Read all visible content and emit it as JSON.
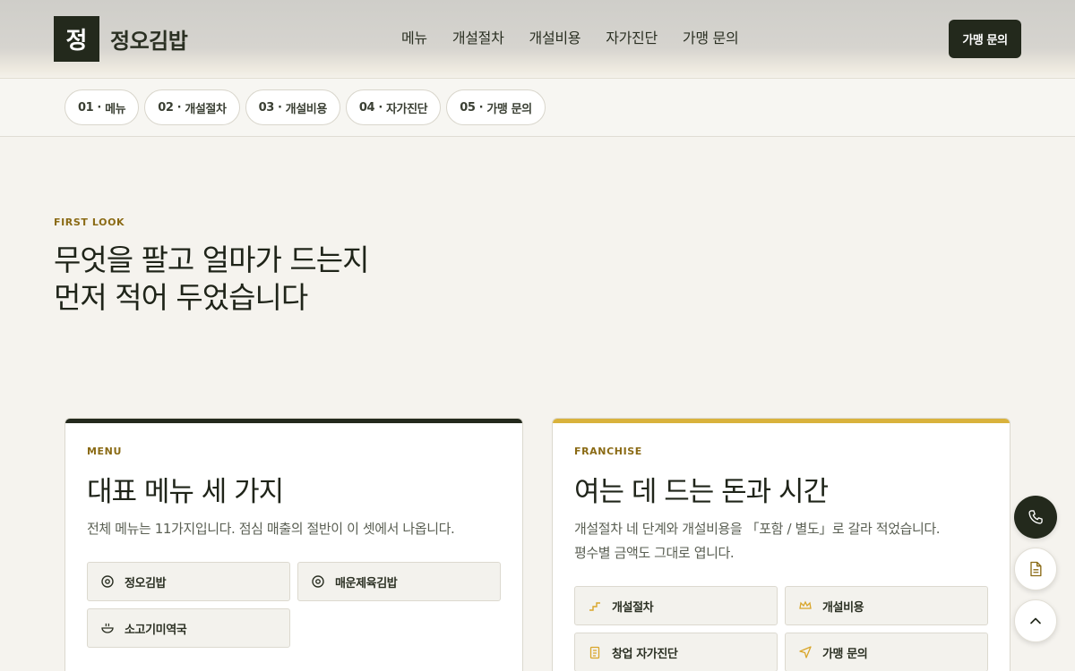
{
  "header": {
    "logo_mark": "정",
    "brand_name": "정오김밥",
    "nav": [
      "메뉴",
      "개설절차",
      "개설비용",
      "자가진단",
      "가맹 문의"
    ],
    "cta_label": "가맹 문의"
  },
  "steps": [
    {
      "num": "01",
      "label": "메뉴"
    },
    {
      "num": "02",
      "label": "개설절차"
    },
    {
      "num": "03",
      "label": "개설비용"
    },
    {
      "num": "04",
      "label": "자가진단"
    },
    {
      "num": "05",
      "label": "가맹 문의"
    }
  ],
  "hero": {
    "eyebrow": "FIRST LOOK",
    "title_line1": "무엇을 팔고 얼마가 드는지",
    "title_line2": "먼저 적어 두었습니다"
  },
  "menu_card": {
    "eyebrow": "MENU",
    "title": "대표 메뉴 세 가지",
    "desc": "전체 메뉴는 11가지입니다. 점심 매출의 절반이 이 셋에서 나옵니다.",
    "items": [
      {
        "label": "정오김밥",
        "icon": "target-icon"
      },
      {
        "label": "매운제육김밥",
        "icon": "target-icon"
      },
      {
        "label": "소고기미역국",
        "icon": "bowl-icon"
      }
    ]
  },
  "franchise_card": {
    "eyebrow": "FRANCHISE",
    "title": "여는 데 드는 돈과 시간",
    "desc_line1": "개설절차 네 단계와 개설비용을 「포함 / 별도」로 갈라 적었습니다.",
    "desc_line2": "평수별 금액도 그대로 엽니다.",
    "items": [
      {
        "label": "개설절차",
        "icon": "stairs-icon"
      },
      {
        "label": "개설비용",
        "icon": "crown-icon"
      },
      {
        "label": "창업 자가진단",
        "icon": "clipboard-icon"
      },
      {
        "label": "가맹 문의",
        "icon": "send-icon"
      }
    ]
  },
  "colors": {
    "primary": "#23291c",
    "accent": "#d9b23c",
    "eyebrow": "#8a6a14",
    "background": "#f5f3ee"
  },
  "floating": [
    "phone-icon",
    "document-icon",
    "chevron-up-icon"
  ]
}
